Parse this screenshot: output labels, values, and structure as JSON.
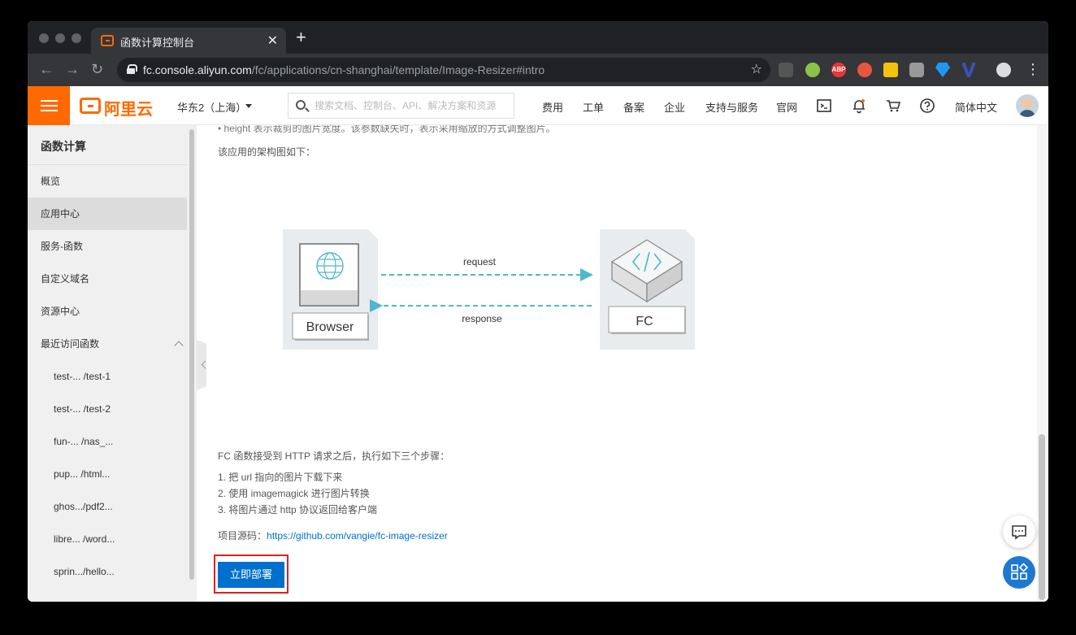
{
  "browser": {
    "tab_title": "函数计算控制台",
    "tab_close": "✕",
    "new_tab": "+",
    "url_host": "fc.console.aliyun.com",
    "url_path": "/fc/applications/cn-shanghai/template/Image-Resizer#intro",
    "extensions": [
      "ABP"
    ]
  },
  "header": {
    "logo_text": "阿里云",
    "region": "华东2（上海）",
    "search_placeholder": "搜索文档、控制台、API、解决方案和资源",
    "nav": [
      "费用",
      "工单",
      "备案",
      "企业",
      "支持与服务",
      "官网"
    ],
    "language": "简体中文"
  },
  "sidebar": {
    "title": "函数计算",
    "items": [
      "概览",
      "应用中心",
      "服务-函数",
      "自定义域名",
      "资源中心",
      "最近访问函数"
    ],
    "active_item": "应用中心",
    "recent": [
      "test-... /test-1",
      "test-... /test-2",
      "fun-...  /nas_...",
      "pup...  /html...",
      "ghos.../pdf2...",
      "libre...  /word...",
      "sprin.../hello..."
    ]
  },
  "content": {
    "cut_text": "• height 表示裁剪的图片宽度。该参数缺失时，表示采用缩放的方式调整图片。",
    "arch_intro": "该应用的架构图如下：",
    "diagram": {
      "left_label": "Browser",
      "right_label": "FC",
      "request_label": "request",
      "response_label": "response"
    },
    "steps_intro": "FC 函数接受到 HTTP 请求之后，执行如下三个步骤：",
    "steps": [
      "1. 把 url 指向的图片下载下来",
      "2. 使用 imagemagick 进行图片转换",
      "3. 将图片通过 http 协议返回给客户端"
    ],
    "source_label": "项目源码：",
    "source_link": "https://github.com/vangie/fc-image-resizer",
    "deploy_button": "立即部署"
  },
  "colors": {
    "brand_orange": "#ff6a00",
    "primary_blue": "#0070cc",
    "highlight_red": "#e02020",
    "diagram_cyan": "#4db8cc"
  }
}
